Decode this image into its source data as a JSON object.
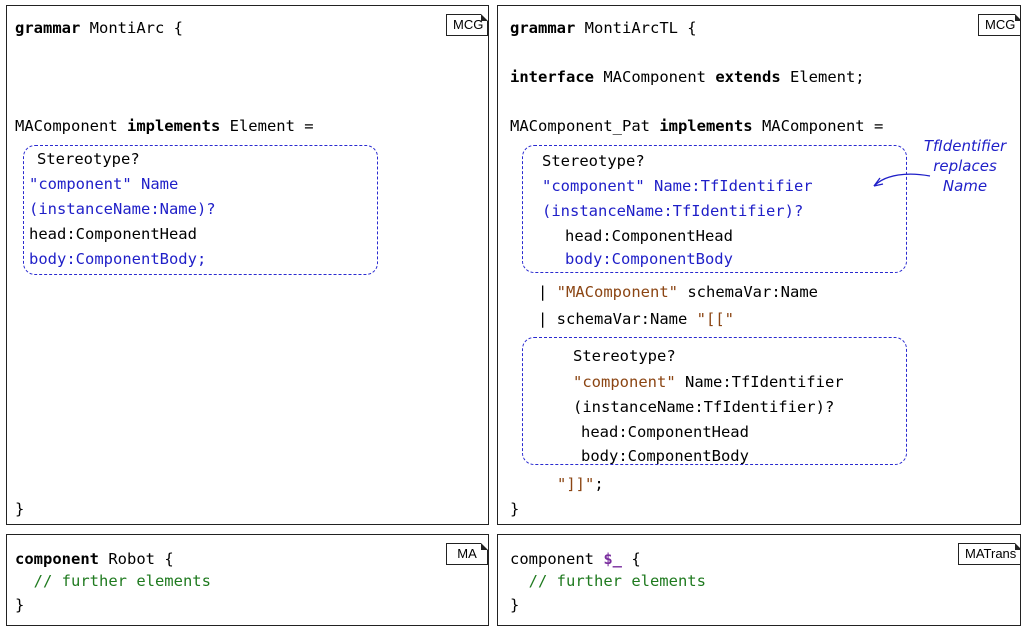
{
  "panels": {
    "top_left": {
      "badge": "MCG",
      "header_kw": "grammar",
      "header_rest": " MontiArc {",
      "rule_start": "MAComponent ",
      "rule_kw": "implements",
      "rule_rest": " Element =",
      "box_lines": [
        "Stereotype?",
        "\"component\" Name",
        "(instanceName:Name)?",
        "head:ComponentHead",
        "body:ComponentBody;"
      ],
      "close": "}"
    },
    "top_right": {
      "badge": "MCG",
      "header_kw": "grammar",
      "header_rest": " MontiArcTL {",
      "iface_kw": "interface",
      "iface_mid": " MAComponent ",
      "iface_kw2": "extends",
      "iface_rest": " Element;",
      "rule_start": "MAComponent_Pat ",
      "rule_kw": "implements",
      "rule_rest": " MAComponent =",
      "box1_lines": [
        "Stereotype?",
        "\"component\" Name:TfIdentifier",
        "(instanceName:TfIdentifier)?",
        "head:ComponentHead",
        "body:ComponentBody"
      ],
      "alt1_bar": "| ",
      "alt1_str": "\"MAComponent\"",
      "alt1_rest": " schemaVar:Name",
      "alt2_bar": "| schemaVar:Name ",
      "alt2_str": "\"[[\"",
      "box2_line1": "Stereotype?",
      "box2_str": "\"component\"",
      "box2_line2_rest": " Name:TfIdentifier",
      "box2_line3": "(instanceName:TfIdentifier)?",
      "box2_line4": "head:ComponentHead",
      "box2_line5": "body:ComponentBody",
      "end_str": "\"]]\"",
      "end_semi": ";",
      "close": "}",
      "note": "TfIdentifier\nreplaces\nName"
    },
    "bottom_left": {
      "badge": "MA",
      "kw": "component",
      "rest": " Robot {",
      "comment": "  // further elements",
      "close": "}"
    },
    "bottom_right": {
      "badge": "MATrans",
      "kw": "component ",
      "var": "$_",
      "rest": " {",
      "comment": "  // further elements",
      "close": "}"
    }
  }
}
